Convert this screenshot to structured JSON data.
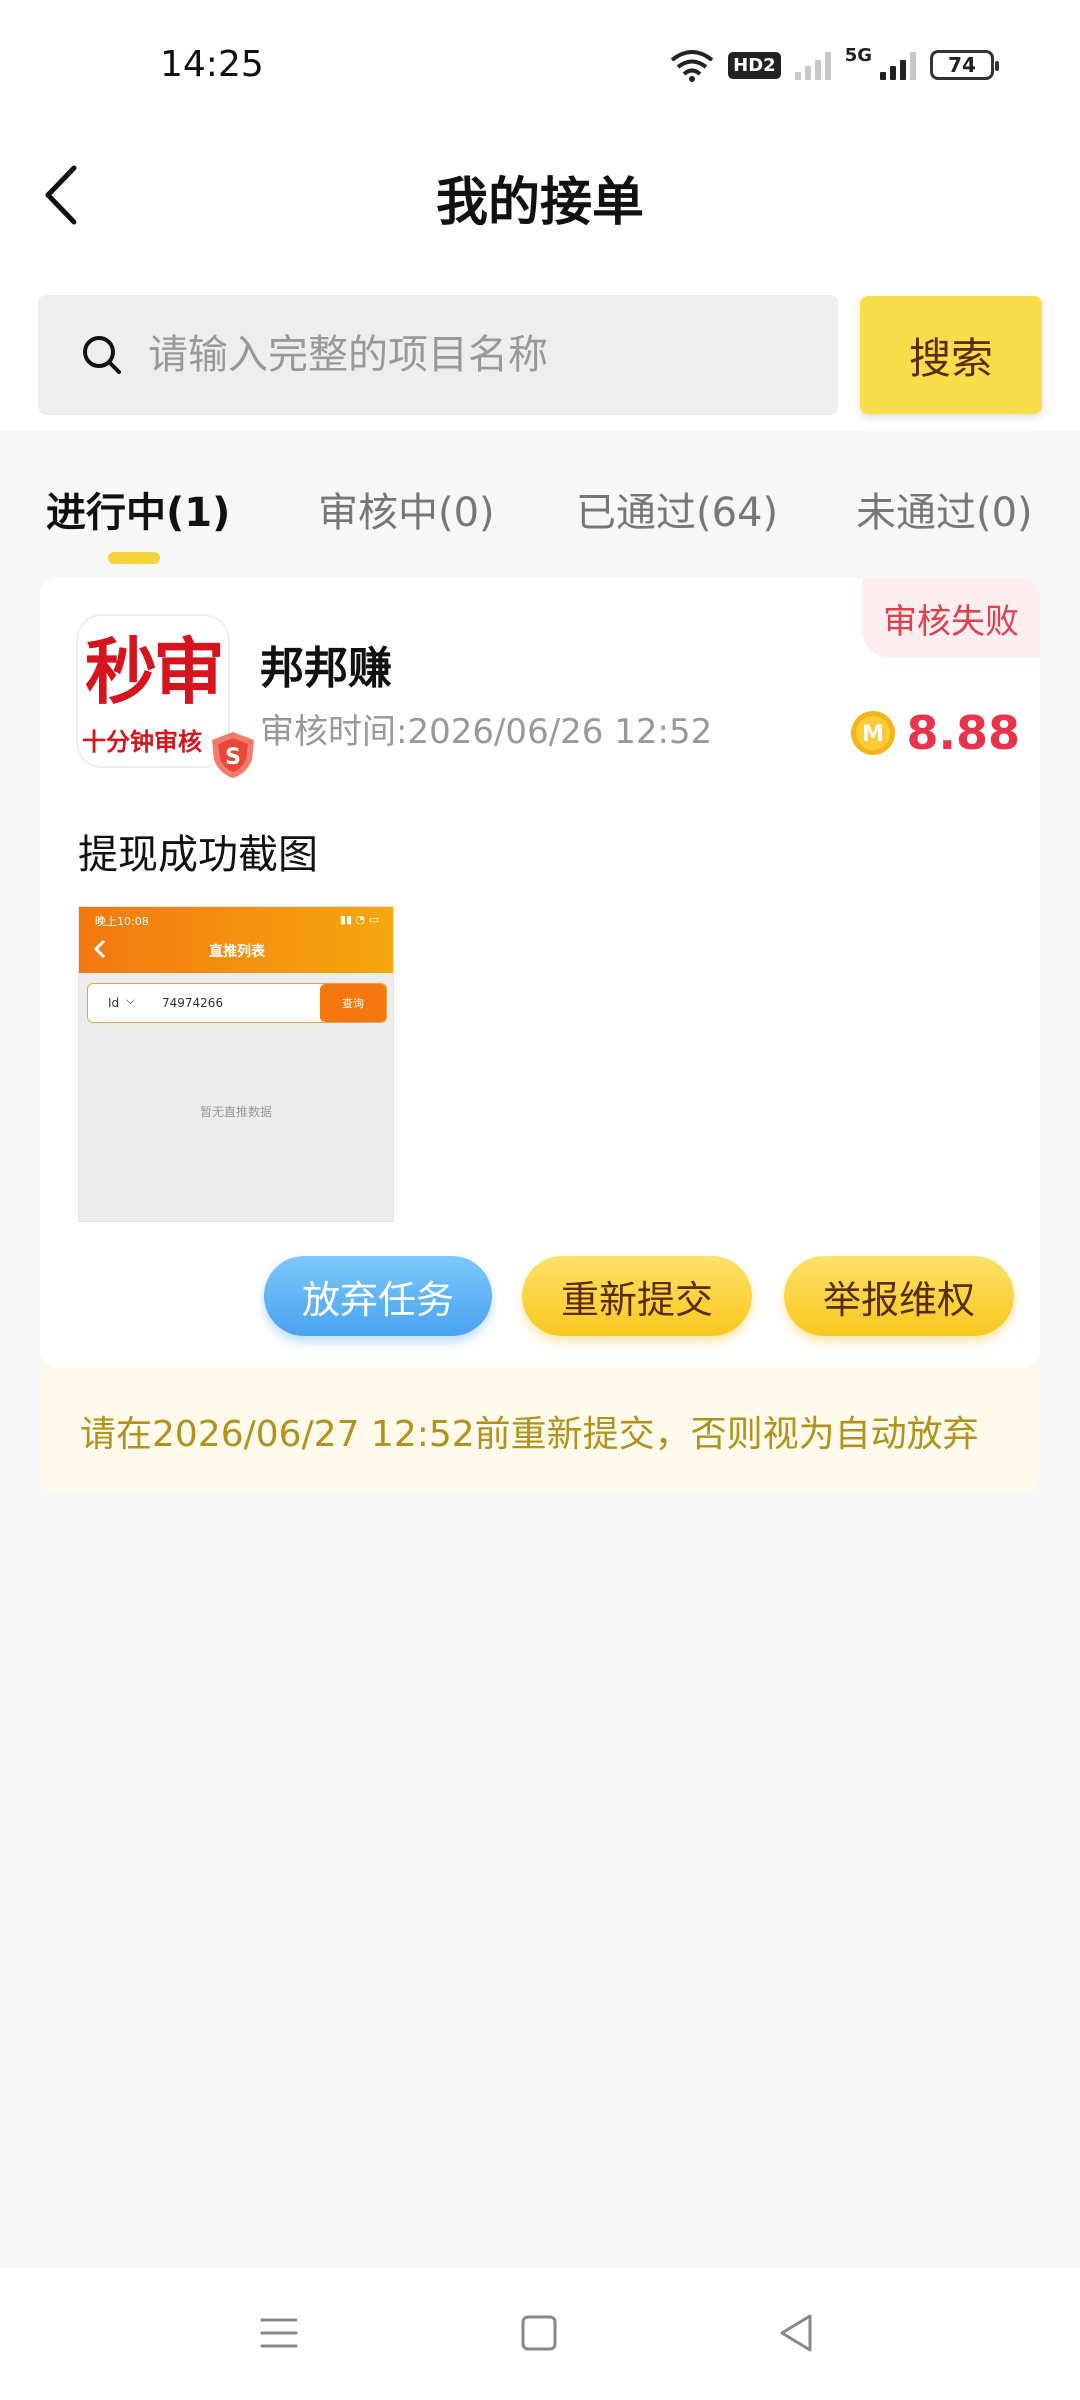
{
  "status_bar": {
    "time": "14:25",
    "hd_label": "HD2",
    "net_label": "5G",
    "battery": "74",
    "icons": [
      "wifi-icon",
      "hd-icon",
      "signal-icon",
      "battery-icon"
    ]
  },
  "header": {
    "title": "我的接单"
  },
  "search": {
    "placeholder": "请输入完整的项目名称",
    "value": "",
    "button_label": "搜索"
  },
  "tabs": [
    {
      "label": "进行中(1)",
      "active": true
    },
    {
      "label": "审核中(0)",
      "active": false
    },
    {
      "label": "已通过(64)",
      "active": false
    },
    {
      "label": "未通过(0)",
      "active": false
    }
  ],
  "task": {
    "status": "审核失败",
    "app_icon_text": "秒审",
    "app_icon_subtext": "十分钟审核",
    "name": "邦邦赚",
    "review_time": "审核时间:2026/06/26 12:52",
    "reward": "8.88",
    "coin_letter": "M",
    "proof_label": "提现成功截图",
    "proof_screenshot": {
      "status_left": "晚上10:08",
      "title": "直推列表",
      "select_label": "Id",
      "input_value": "74974266",
      "query_button": "查询",
      "empty_text": "暂无直推数据"
    },
    "actions": {
      "abandon": "放弃任务",
      "resubmit": "重新提交",
      "report": "举报维权"
    },
    "notice": "请在2026/06/27 12:52前重新提交，否则视为自动放弃"
  },
  "colors": {
    "accent_yellow": "#f9dd4a",
    "reward_red": "#e8344a",
    "fail_red": "#e04050",
    "abandon_blue": "#4aa3f2",
    "notice_text": "#b2921a"
  }
}
